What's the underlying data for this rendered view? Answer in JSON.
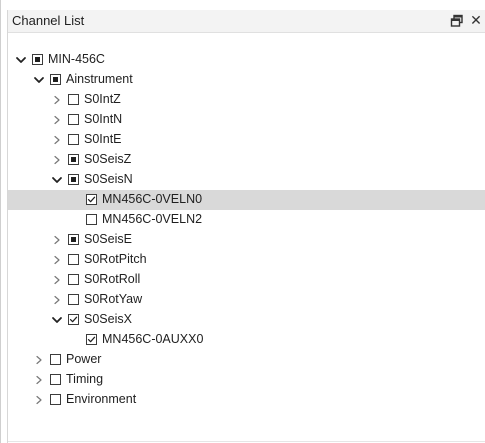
{
  "panel": {
    "title": "Channel List"
  },
  "icons": {
    "float": "float-window-icon",
    "close": "close-icon",
    "expanded": "chevron-down-icon",
    "collapsed": "chevron-right-icon"
  },
  "tree": {
    "items": [
      {
        "label": "MIN-456C",
        "level": 0,
        "expander": "expanded",
        "check": "partial",
        "selected": false
      },
      {
        "label": "Ainstrument",
        "level": 1,
        "expander": "expanded",
        "check": "partial",
        "selected": false
      },
      {
        "label": "S0IntZ",
        "level": 2,
        "expander": "collapsed",
        "check": "unchecked",
        "selected": false
      },
      {
        "label": "S0IntN",
        "level": 2,
        "expander": "collapsed",
        "check": "unchecked",
        "selected": false
      },
      {
        "label": "S0IntE",
        "level": 2,
        "expander": "collapsed",
        "check": "unchecked",
        "selected": false
      },
      {
        "label": "S0SeisZ",
        "level": 2,
        "expander": "collapsed",
        "check": "partial",
        "selected": false
      },
      {
        "label": "S0SeisN",
        "level": 2,
        "expander": "expanded",
        "check": "partial",
        "selected": false
      },
      {
        "label": "MN456C-0VELN0",
        "level": 3,
        "expander": "none",
        "check": "checked",
        "selected": true
      },
      {
        "label": "MN456C-0VELN2",
        "level": 3,
        "expander": "none",
        "check": "unchecked",
        "selected": false
      },
      {
        "label": "S0SeisE",
        "level": 2,
        "expander": "collapsed",
        "check": "partial",
        "selected": false
      },
      {
        "label": "S0RotPitch",
        "level": 2,
        "expander": "collapsed",
        "check": "unchecked",
        "selected": false
      },
      {
        "label": "S0RotRoll",
        "level": 2,
        "expander": "collapsed",
        "check": "unchecked",
        "selected": false
      },
      {
        "label": "S0RotYaw",
        "level": 2,
        "expander": "collapsed",
        "check": "unchecked",
        "selected": false
      },
      {
        "label": "S0SeisX",
        "level": 2,
        "expander": "expanded",
        "check": "checked",
        "selected": false
      },
      {
        "label": "MN456C-0AUXX0",
        "level": 3,
        "expander": "none",
        "check": "checked",
        "selected": false
      },
      {
        "label": "Power",
        "level": 1,
        "expander": "collapsed",
        "check": "unchecked",
        "selected": false
      },
      {
        "label": "Timing",
        "level": 1,
        "expander": "collapsed",
        "check": "unchecked",
        "selected": false
      },
      {
        "label": "Environment",
        "level": 1,
        "expander": "collapsed",
        "check": "unchecked",
        "selected": false
      }
    ]
  }
}
